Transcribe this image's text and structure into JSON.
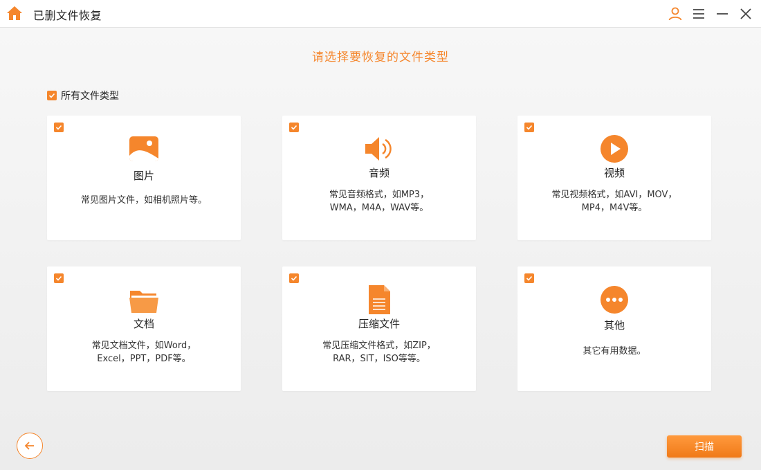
{
  "titlebar": {
    "title": "已删文件恢复",
    "icons": {
      "home": "home-icon",
      "user": "user-icon",
      "menu": "menu-icon",
      "minimize": "minimize-icon",
      "close": "close-icon"
    }
  },
  "main": {
    "heading": "请选择要恢复的文件类型",
    "select_all": {
      "label": "所有文件类型",
      "checked": true
    },
    "categories": [
      {
        "label": "图片",
        "desc_line1": "常见图片文件，如相机照片等。",
        "desc_line2": "",
        "icon": "image-icon",
        "checked": true
      },
      {
        "label": "音频",
        "desc_line1": "常见音频格式，如MP3，",
        "desc_line2": "WMA，M4A，WAV等。",
        "icon": "speaker-icon",
        "checked": true
      },
      {
        "label": "视频",
        "desc_line1": "常见视频格式，如AVI，MOV，",
        "desc_line2": "MP4，M4V等。",
        "icon": "play-icon",
        "checked": true
      },
      {
        "label": "文档",
        "desc_line1": "常见文档文件，如Word，",
        "desc_line2": "Excel，PPT，PDF等。",
        "icon": "folder-icon",
        "checked": true
      },
      {
        "label": "压缩文件",
        "desc_line1": "常见压缩文件格式，如ZIP，",
        "desc_line2": "RAR，SIT，ISO等等。",
        "icon": "file-icon",
        "checked": true
      },
      {
        "label": "其他",
        "desc_line1": "其它有用数据。",
        "desc_line2": "",
        "icon": "more-icon",
        "checked": true
      }
    ]
  },
  "footer": {
    "back_icon": "back-arrow-icon",
    "scan_label": "扫描"
  },
  "colors": {
    "accent": "#f5862c",
    "card_bg": "#ffffff",
    "page_bg": "#f3f3f3"
  }
}
